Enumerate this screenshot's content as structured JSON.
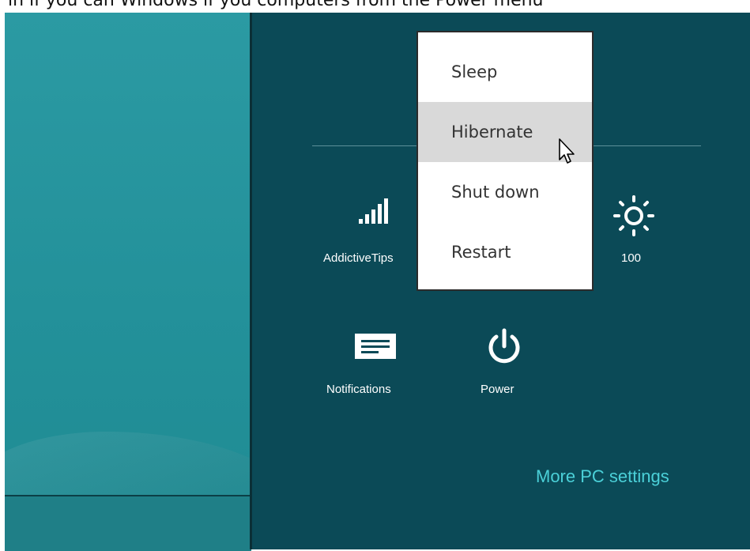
{
  "top_caption": "in if you can Windows if you computers from the Power menu",
  "charm": {
    "network_label": "AddictiveTips",
    "brightness_label": "100",
    "notifications_label": "Notifications",
    "power_label": "Power",
    "more_settings": "More PC settings"
  },
  "power_menu": {
    "items": [
      {
        "label": "Sleep"
      },
      {
        "label": "Hibernate"
      },
      {
        "label": "Shut down"
      },
      {
        "label": "Restart"
      }
    ],
    "hovered": "Hibernate"
  },
  "colors": {
    "charm_bg": "#0b4a57",
    "desktop_bg": "#23919a",
    "link": "#4bd0d8",
    "menu_hover": "#d9d9d9"
  }
}
